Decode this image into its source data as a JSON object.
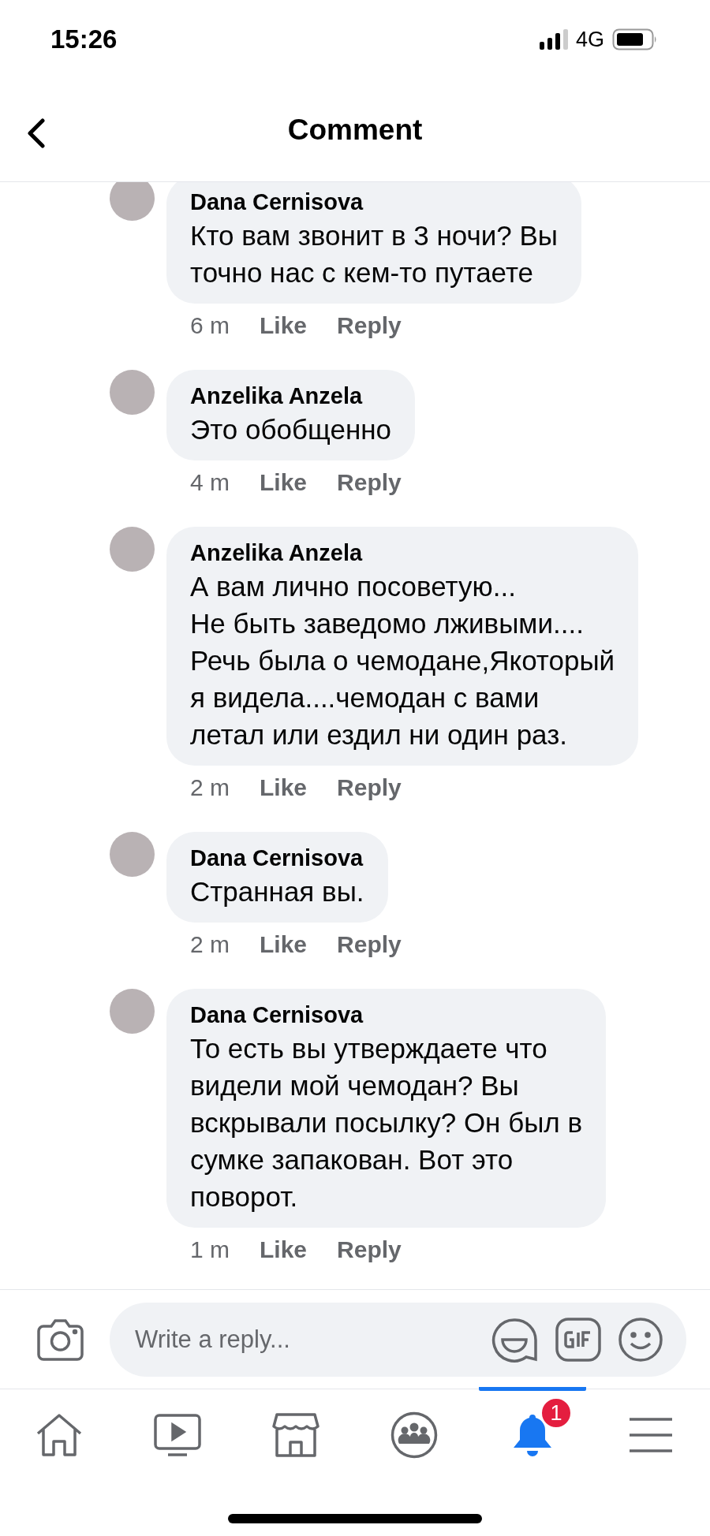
{
  "status_bar": {
    "time": "15:26",
    "network": "4G"
  },
  "header": {
    "title": "Comment"
  },
  "comments": [
    {
      "author": "Dana Cernisova",
      "text": "Кто вам звонит в 3 ночи? Вы\nточно нас с кем-то путаете",
      "time": "6 m",
      "like": "Like",
      "reply": "Reply"
    },
    {
      "author": "Anzelika Anzela",
      "text": "Это обобщенно",
      "time": "4 m",
      "like": "Like",
      "reply": "Reply"
    },
    {
      "author": "Anzelika Anzela",
      "text": "А вам лично посоветую...\nНе быть заведомо лживыми....\nРечь была о чемодане,Якоторый\nя видела....чемодан с вами\nлетал или ездил ни один раз.",
      "time": "2 m",
      "like": "Like",
      "reply": "Reply"
    },
    {
      "author": "Dana Cernisova",
      "text": "Странная вы.",
      "time": "2 m",
      "like": "Like",
      "reply": "Reply"
    },
    {
      "author": "Dana Cernisova",
      "text": "То есть вы утверждаете что\nвидели мой чемодан? Вы\nвскрывали посылку? Он был в\nсумке запакован. Вот это\nповорот.",
      "time": "1 m",
      "like": "Like",
      "reply": "Reply"
    }
  ],
  "reply_field": {
    "placeholder": "Write a reply..."
  },
  "tab_bar": [
    {
      "kind": "home",
      "selected": false
    },
    {
      "kind": "video",
      "selected": false
    },
    {
      "kind": "marketplace",
      "selected": false
    },
    {
      "kind": "groups",
      "selected": false
    },
    {
      "kind": "notifications",
      "selected": true,
      "badge": "1"
    },
    {
      "kind": "menu",
      "selected": false
    }
  ]
}
